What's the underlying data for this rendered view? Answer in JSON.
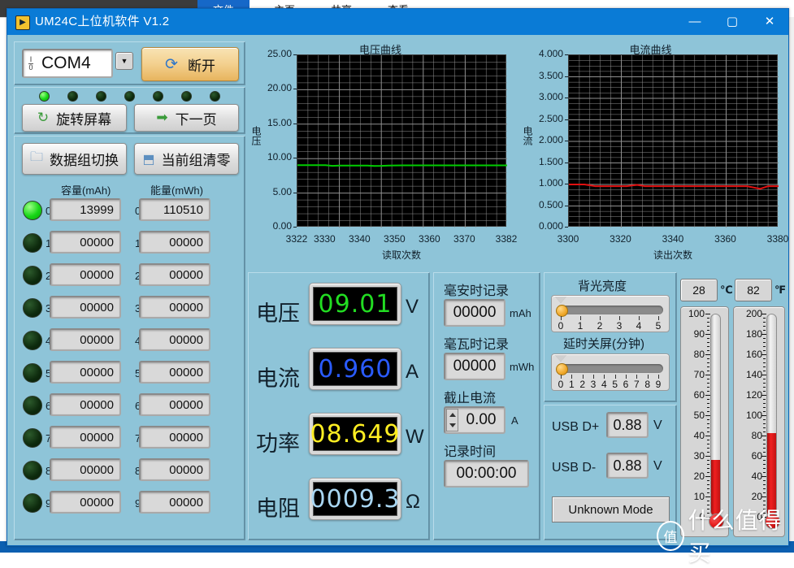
{
  "background_window": {
    "tabs": [
      {
        "label": "文件"
      },
      {
        "label": "主页"
      },
      {
        "label": "共享"
      },
      {
        "label": "查看"
      }
    ]
  },
  "window": {
    "title": "UM24C上位机软件 V1.2",
    "icon": "app-icon",
    "minimize_label": "—",
    "maximize_label": "▢",
    "close_label": "✕"
  },
  "connection": {
    "port_value": "COM4",
    "port_icon": "io-icon",
    "dropdown_icon": "chevron-down-icon",
    "connect_button_label": "断开",
    "connect_button_icon": "refresh-icon"
  },
  "leds": {
    "states": [
      "on",
      "off",
      "off",
      "off",
      "off",
      "off",
      "off"
    ]
  },
  "screen_controls": {
    "rotate_label": "旋转屏幕",
    "rotate_icon": "rotate-icon",
    "next_page_label": "下一页",
    "next_page_icon": "arrow-right-icon"
  },
  "group_controls": {
    "switch_label": "数据组切换",
    "switch_icon": "folder-icon",
    "clear_label": "当前组清零",
    "clear_icon": "erase-icon"
  },
  "groups": {
    "capacity_header": "容量(mAh)",
    "energy_header": "能量(mWh)",
    "rows": [
      {
        "index": "0",
        "led": "on",
        "capacity": "13999",
        "energy": "110510"
      },
      {
        "index": "1",
        "led": "off",
        "capacity": "00000",
        "energy": "00000"
      },
      {
        "index": "2",
        "led": "off",
        "capacity": "00000",
        "energy": "00000"
      },
      {
        "index": "3",
        "led": "off",
        "capacity": "00000",
        "energy": "00000"
      },
      {
        "index": "4",
        "led": "off",
        "capacity": "00000",
        "energy": "00000"
      },
      {
        "index": "5",
        "led": "off",
        "capacity": "00000",
        "energy": "00000"
      },
      {
        "index": "6",
        "led": "off",
        "capacity": "00000",
        "energy": "00000"
      },
      {
        "index": "7",
        "led": "off",
        "capacity": "00000",
        "energy": "00000"
      },
      {
        "index": "8",
        "led": "off",
        "capacity": "00000",
        "energy": "00000"
      },
      {
        "index": "9",
        "led": "off",
        "capacity": "00000",
        "energy": "00000"
      }
    ]
  },
  "readouts": [
    {
      "label": "电压",
      "value": "09.01",
      "unit": "V",
      "color": "#22dd22"
    },
    {
      "label": "电流",
      "value": "0.960",
      "unit": "A",
      "color": "#2a5bff"
    },
    {
      "label": "功率",
      "value": "08.649",
      "unit": "W",
      "color": "#ffee22"
    },
    {
      "label": "电阻",
      "value": "0009.3",
      "unit": "Ω",
      "color": "#a9d6f2"
    }
  ],
  "records": {
    "mah_label": "毫安时记录",
    "mah_value": "00000",
    "mah_unit": "mAh",
    "mwh_label": "毫瓦时记录",
    "mwh_value": "00000",
    "mwh_unit": "mWh",
    "cutoff_label": "截止电流",
    "cutoff_value": "0.00",
    "cutoff_unit": "A",
    "time_label": "记录时间",
    "time_value": "00:00:00"
  },
  "settings": {
    "backlight_label": "背光亮度",
    "backlight_value": 0,
    "backlight_ticks": [
      "0",
      "1",
      "2",
      "3",
      "4",
      "5"
    ],
    "timeout_label": "延时关屏(分钟)",
    "timeout_value": 0,
    "timeout_ticks": [
      "0",
      "1",
      "2",
      "3",
      "4",
      "5",
      "6",
      "7",
      "8",
      "9"
    ]
  },
  "usb": {
    "dplus_label": "USB D+",
    "dplus_value": "0.88",
    "dplus_unit": "V",
    "dminus_label": "USB D-",
    "dminus_value": "0.88",
    "dminus_unit": "V",
    "mode_label": "Unknown Mode"
  },
  "temperature": {
    "celsius_value": "28",
    "celsius_unit": "℃",
    "fahrenheit_value": "82",
    "fahrenheit_unit": "℉",
    "celsius_ticks": [
      "100",
      "90",
      "80",
      "70",
      "60",
      "50",
      "40",
      "30",
      "20",
      "10",
      "0"
    ],
    "fahrenheit_ticks": [
      "200",
      "180",
      "160",
      "140",
      "120",
      "100",
      "80",
      "60",
      "40",
      "20",
      "0"
    ],
    "celsius_max": 100,
    "fahrenheit_max": 200
  },
  "watermark": {
    "logo_text": "值",
    "text": "什么值得买"
  },
  "chart_data": [
    {
      "type": "line",
      "title": "电压曲线",
      "xlabel": "读取次数",
      "ylabel": "电压",
      "ylim": [
        0,
        25
      ],
      "xlim": [
        3322,
        3382
      ],
      "ytick_labels": [
        "25.00",
        "20.00",
        "15.00",
        "10.00",
        "5.00",
        "0.00"
      ],
      "xtick_labels": [
        "3322",
        "3330",
        "3340",
        "3350",
        "3360",
        "3370",
        "3382"
      ],
      "grid": true,
      "series": [
        {
          "name": "电压",
          "color": "#00cc00",
          "x": [
            3322,
            3326,
            3330,
            3332,
            3334,
            3338,
            3342,
            3344,
            3346,
            3348,
            3352,
            3358,
            3364,
            3370,
            3376,
            3382
          ],
          "values": [
            9.05,
            9.05,
            9.05,
            8.95,
            9.0,
            9.0,
            9.0,
            8.93,
            8.95,
            9.0,
            9.02,
            9.02,
            9.02,
            9.02,
            9.02,
            9.02
          ]
        }
      ]
    },
    {
      "type": "line",
      "title": "电流曲线",
      "xlabel": "读出次数",
      "ylabel": "电流",
      "ylim": [
        0,
        4
      ],
      "xlim": [
        3300,
        3380
      ],
      "ytick_labels": [
        "4.000",
        "3.500",
        "3.000",
        "2.500",
        "2.000",
        "1.500",
        "1.000",
        "0.500",
        "0.000"
      ],
      "xtick_labels": [
        "3300",
        "3320",
        "3340",
        "3360",
        "3380"
      ],
      "grid": true,
      "series": [
        {
          "name": "电流",
          "color": "#e01010",
          "x": [
            3300,
            3306,
            3310,
            3316,
            3322,
            3326,
            3329,
            3334,
            3342,
            3350,
            3360,
            3368,
            3373,
            3376,
            3380
          ],
          "values": [
            1.0,
            1.0,
            0.96,
            0.96,
            0.96,
            0.99,
            0.96,
            0.96,
            0.96,
            0.96,
            0.96,
            0.96,
            0.9,
            0.96,
            0.96
          ]
        }
      ]
    }
  ]
}
